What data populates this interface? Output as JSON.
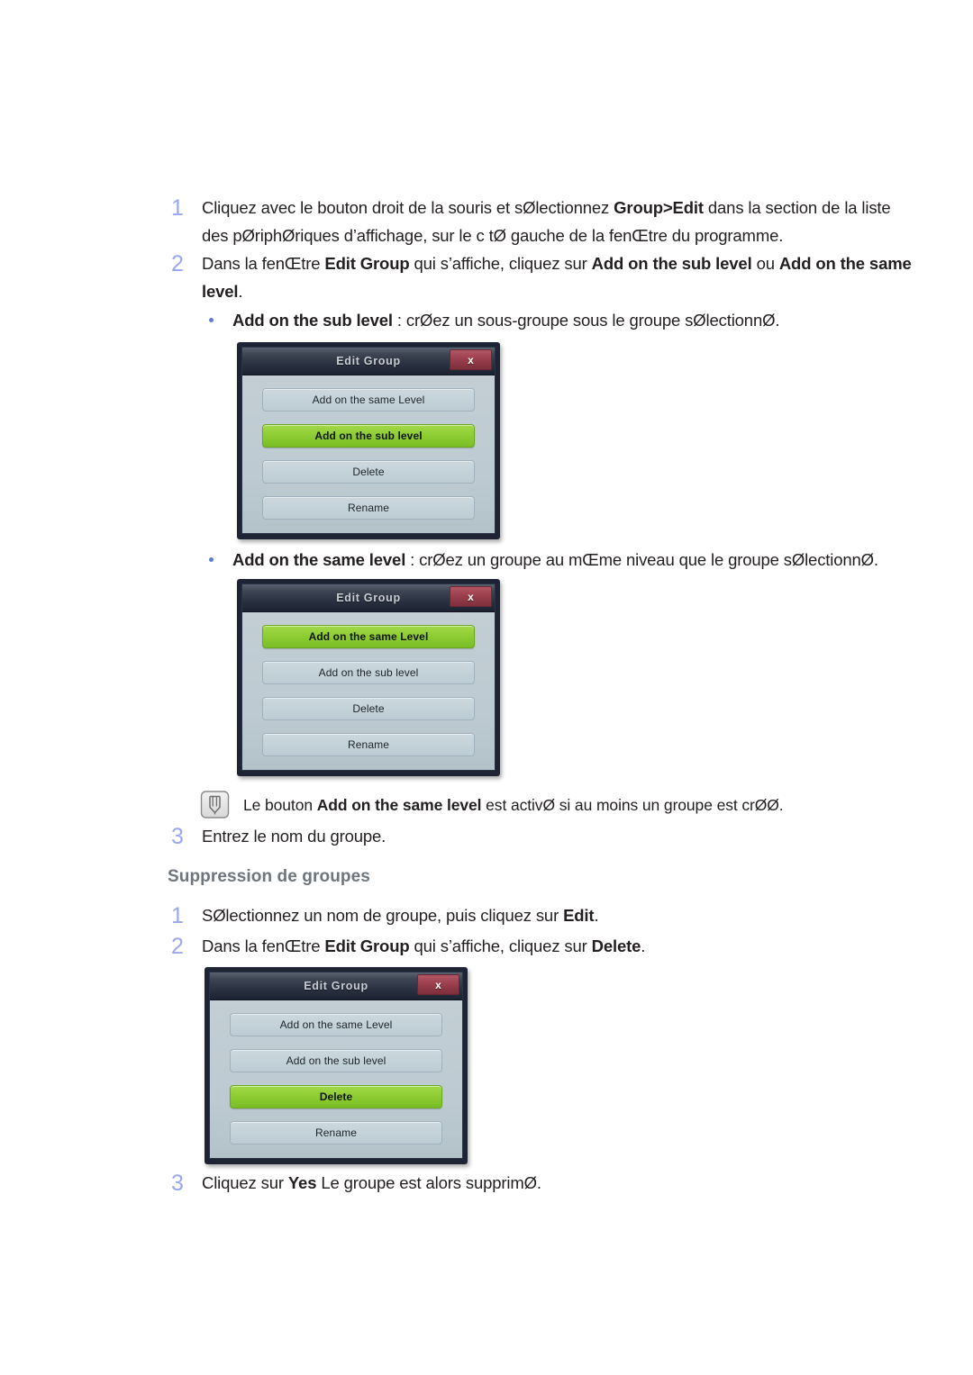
{
  "page": {
    "language": "fr"
  },
  "steps_add": [
    {
      "number": "1",
      "text_html": "Cliquez avec le bouton droit de la souris et sØlectionnez <b>Group&gt;Edit</b> dans la section de la liste des pØriphØriques d’affichage, sur le c tØ gauche de la fenŒtre du programme."
    },
    {
      "number": "2",
      "text_html": "Dans la fenŒtre <b>Edit Group</b> qui s’affiche, cliquez sur <b>Add on the sub level</b> ou <b>Add on the same level</b>."
    },
    {
      "number": "3",
      "text_html": "Entrez le nom du groupe."
    }
  ],
  "bullets": [
    {
      "text_html": "<b>Add on the sub level</b> : crØez un sous-groupe sous le groupe sØlectionnØ."
    },
    {
      "text_html": "<b>Add on the same level</b> : crØez un groupe au mŒme niveau que le groupe sØlectionnØ."
    }
  ],
  "note": {
    "icon": "note-pencil-icon",
    "text_html": "Le bouton <b>Add on the same level</b> est activØ si au moins un groupe est crØØ."
  },
  "section_heading": "Suppression de groupes",
  "steps_delete": [
    {
      "number": "1",
      "text_html": "SØlectionnez un nom de groupe, puis cliquez sur <b>Edit</b>."
    },
    {
      "number": "2",
      "text_html": "Dans la fenŒtre <b>Edit Group</b> qui s’affiche, cliquez sur <b>Delete</b>."
    },
    {
      "number": "3",
      "text_html": "Cliquez sur <b>Yes</b> Le groupe est alors supprimØ."
    }
  ],
  "dialogs": [
    {
      "id": "dialog-sub-level",
      "title": "Edit Group",
      "close_label": "x",
      "buttons": [
        {
          "label": "Add on the same Level",
          "state": "normal"
        },
        {
          "label": "Add on the sub level",
          "state": "active"
        },
        {
          "label": "Delete",
          "state": "normal"
        },
        {
          "label": "Rename",
          "state": "normal"
        }
      ]
    },
    {
      "id": "dialog-same-level",
      "title": "Edit Group",
      "close_label": "x",
      "buttons": [
        {
          "label": "Add on the same Level",
          "state": "active"
        },
        {
          "label": "Add on the sub level",
          "state": "normal"
        },
        {
          "label": "Delete",
          "state": "normal"
        },
        {
          "label": "Rename",
          "state": "normal"
        }
      ]
    },
    {
      "id": "dialog-delete",
      "title": "Edit Group",
      "close_label": "x",
      "buttons": [
        {
          "label": "Add on the same Level",
          "state": "normal"
        },
        {
          "label": "Add on the sub level",
          "state": "normal"
        },
        {
          "label": "Delete",
          "state": "active"
        },
        {
          "label": "Rename",
          "state": "normal"
        }
      ]
    }
  ],
  "colors": {
    "step_number": "#9aa6ef",
    "bullet_dot": "#5d7bd5",
    "heading": "#6e757c",
    "body_text": "#231f20",
    "dialog_accent_green": "#8fce33",
    "dialog_close_red": "#9c3f4e",
    "dialog_titlebar": "#2a3140",
    "dialog_body": "#c2ced4"
  }
}
